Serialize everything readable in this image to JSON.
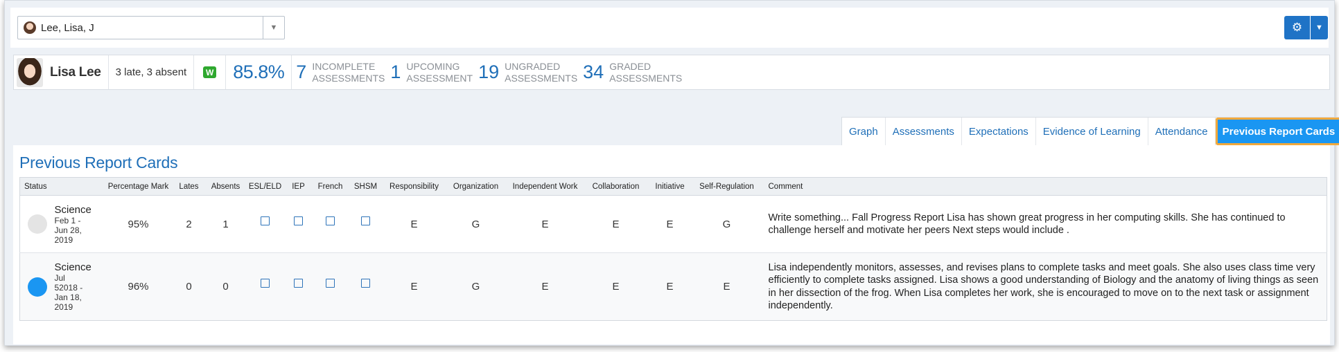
{
  "header": {
    "student_select": {
      "value": "Lee, Lisa, J"
    },
    "settings_icon": "gear-icon",
    "caret_icon": "chevron-down-icon"
  },
  "summary": {
    "name": "Lisa Lee",
    "attendance": "3 late, 3 absent",
    "badge": "W",
    "percentage": "85.8%",
    "stats": [
      {
        "num": "7",
        "line1": "INCOMPLETE",
        "line2": "ASSESSMENTS"
      },
      {
        "num": "1",
        "line1": "UPCOMING",
        "line2": "ASSESSMENT"
      },
      {
        "num": "19",
        "line1": "UNGRADED",
        "line2": "ASSESSMENTS"
      },
      {
        "num": "34",
        "line1": "GRADED",
        "line2": "ASSESSMENTS"
      }
    ]
  },
  "tabs": [
    "Graph",
    "Assessments",
    "Expectations",
    "Evidence of Learning",
    "Attendance",
    "Previous Report Cards"
  ],
  "active_tab": "Previous Report Cards",
  "panel": {
    "title": "Previous Report Cards",
    "columns": [
      "Status",
      "",
      "Percentage Mark",
      "Lates",
      "Absents",
      "ESL/ELD",
      "IEP",
      "French",
      "SHSM",
      "Responsibility",
      "Organization",
      "Independent Work",
      "Collaboration",
      "Initiative",
      "Self-Regulation",
      "Comment"
    ],
    "rows": [
      {
        "status_color": "#e4e4e4",
        "course": "Science",
        "dates": "Feb 1 - Jun 28, 2019",
        "percentage": "95%",
        "lates": "2",
        "absents": "1",
        "responsibility": "E",
        "organization": "G",
        "independent_work": "E",
        "collaboration": "E",
        "initiative": "E",
        "self_regulation": "G",
        "comment": "Write something... Fall Progress Report Lisa has shown great progress in her computing skills. She has continued to challenge herself and motivate her peers Next steps would include ."
      },
      {
        "status_color": "#1a96f2",
        "course": "Science",
        "dates": "Jul 52018 - Jan 18, 2019",
        "percentage": "96%",
        "lates": "0",
        "absents": "0",
        "responsibility": "E",
        "organization": "G",
        "independent_work": "E",
        "collaboration": "E",
        "initiative": "E",
        "self_regulation": "E",
        "comment": "Lisa independently monitors, assesses, and revises plans to complete tasks and meet goals. She also uses class time very efficiently to complete tasks assigned. Lisa shows a good understanding of Biology and the anatomy of living things as seen in her dissection of the frog. When Lisa completes her work, she is encouraged to move on to the next task or assignment independently."
      }
    ]
  },
  "colors": {
    "accent": "#1f6fb8",
    "active_tab": "#1a96f2",
    "active_tab_border": "#f2a93b"
  }
}
